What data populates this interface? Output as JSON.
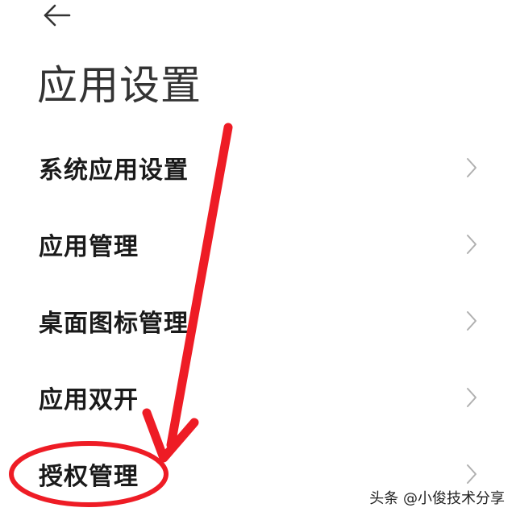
{
  "header": {
    "back_icon": "arrow-left-icon",
    "title": "应用设置"
  },
  "menu": {
    "items": [
      {
        "label": "系统应用设置",
        "icon": "chevron-right-icon"
      },
      {
        "label": "应用管理",
        "icon": "chevron-right-icon"
      },
      {
        "label": "桌面图标管理",
        "icon": "chevron-right-icon"
      },
      {
        "label": "应用双开",
        "icon": "chevron-right-icon"
      },
      {
        "label": "授权管理",
        "icon": "chevron-right-icon"
      }
    ]
  },
  "annotation": {
    "color": "#ee1c25",
    "highlighted_item": "授权管理"
  },
  "watermark": {
    "text": "头条 @小俊技术分享"
  }
}
